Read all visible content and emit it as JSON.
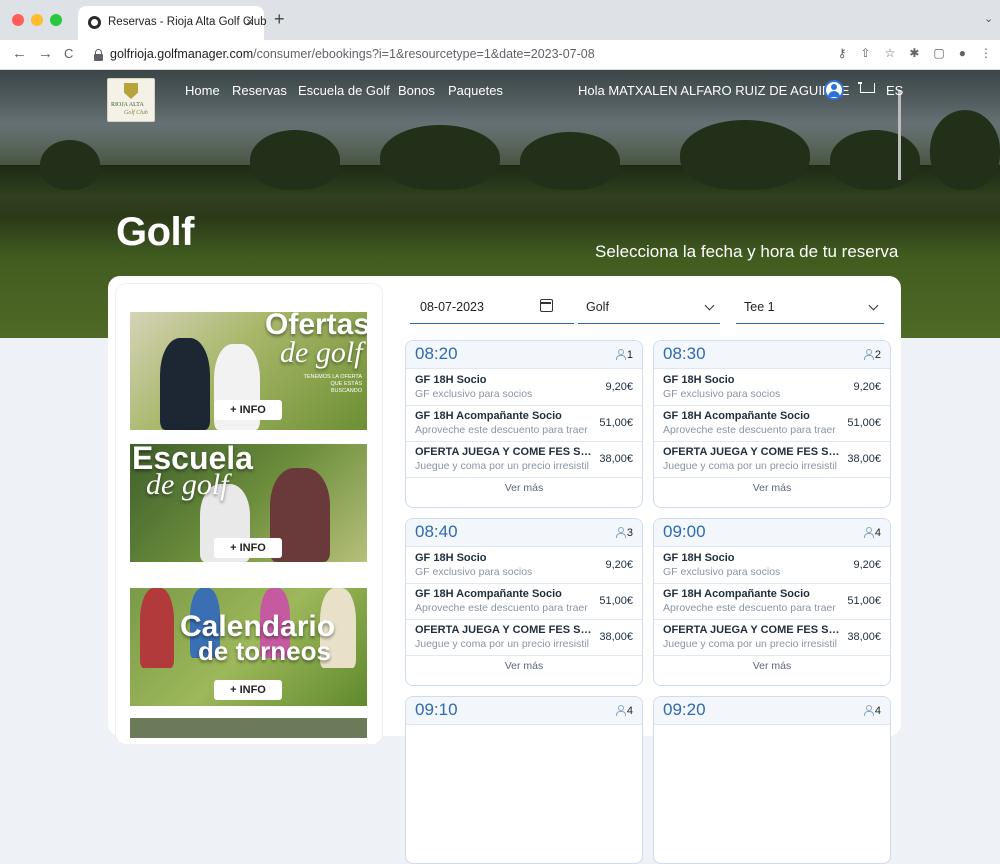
{
  "browser": {
    "tab_title": "Reservas - Rioja Alta Golf Club",
    "tab_close": "×",
    "new_tab": "+",
    "url_host": "golfrioja.golfmanager.com",
    "url_path": "/consumer/ebookings?i=1&resourcetype=1&date=2023-07-08",
    "back": "←",
    "forward": "→",
    "reload": "C",
    "tab_menu": "⌄",
    "extensions": [
      "⚷",
      "⇧",
      "☆",
      "✱",
      "▢",
      "●",
      "⋮"
    ]
  },
  "header": {
    "logo_text": "RIOJA ALTA",
    "logo_sub": "Golf Club",
    "menu": [
      "Home",
      "Reservas",
      "Escuela de Golf",
      "Bonos",
      "Paquetes"
    ],
    "greeting": "Hola MATXALEN ALFARO RUIZ DE AGUIRRE",
    "lang": "ES"
  },
  "hero": {
    "title": "Golf",
    "subtitle": "Selecciona la fecha y hora de tu reserva"
  },
  "sidebar": {
    "banners": [
      {
        "title": "Ofertas",
        "script": "de golf",
        "tagline": "TENEMOS LA OFERTA QUE ESTÁS BUSCANDO",
        "button": "+ INFO"
      },
      {
        "title": "Escuela",
        "script": "de golf",
        "button": "+ INFO"
      },
      {
        "title": "Calendario",
        "script": "de torneos",
        "button": "+ INFO"
      }
    ]
  },
  "filters": {
    "date": "08-07-2023",
    "resource": "Golf",
    "tee": "Tee 1"
  },
  "slots": [
    {
      "time": "08:20",
      "people": "1",
      "fares": [
        {
          "name": "GF 18H Socio",
          "desc": "GF exclusivo para socios",
          "price": "9,20€"
        },
        {
          "name": "GF 18H Acompañante Socio",
          "desc": "Aproveche este descuento para traer",
          "price": "51,00€"
        },
        {
          "name": "OFERTA JUEGA Y COME FES SOC...",
          "desc": "Juegue y coma por un precio irresistil",
          "price": "38,00€"
        }
      ],
      "more": "Ver más"
    },
    {
      "time": "08:30",
      "people": "2",
      "fares": [
        {
          "name": "GF 18H Socio",
          "desc": "GF exclusivo para socios",
          "price": "9,20€"
        },
        {
          "name": "GF 18H Acompañante Socio",
          "desc": "Aproveche este descuento para traer",
          "price": "51,00€"
        },
        {
          "name": "OFERTA JUEGA Y COME FES SOC...",
          "desc": "Juegue y coma por un precio irresistil",
          "price": "38,00€"
        }
      ],
      "more": "Ver más"
    },
    {
      "time": "08:40",
      "people": "3",
      "fares": [
        {
          "name": "GF 18H Socio",
          "desc": "GF exclusivo para socios",
          "price": "9,20€"
        },
        {
          "name": "GF 18H Acompañante Socio",
          "desc": "Aproveche este descuento para traer",
          "price": "51,00€"
        },
        {
          "name": "OFERTA JUEGA Y COME FES SOC...",
          "desc": "Juegue y coma por un precio irresistil",
          "price": "38,00€"
        }
      ],
      "more": "Ver más"
    },
    {
      "time": "09:00",
      "people": "4",
      "fares": [
        {
          "name": "GF 18H Socio",
          "desc": "GF exclusivo para socios",
          "price": "9,20€"
        },
        {
          "name": "GF 18H Acompañante Socio",
          "desc": "Aproveche este descuento para traer",
          "price": "51,00€"
        },
        {
          "name": "OFERTA JUEGA Y COME FES SOC...",
          "desc": "Juegue y coma por un precio irresistil",
          "price": "38,00€"
        }
      ],
      "more": "Ver más"
    },
    {
      "time": "09:10",
      "people": "4",
      "fares": [],
      "more": ""
    },
    {
      "time": "09:20",
      "people": "4",
      "fares": [],
      "more": ""
    }
  ],
  "colors": {
    "accent": "#2d6ab0",
    "slot_border": "#cfdcec",
    "page_bg": "#eef1f6"
  }
}
